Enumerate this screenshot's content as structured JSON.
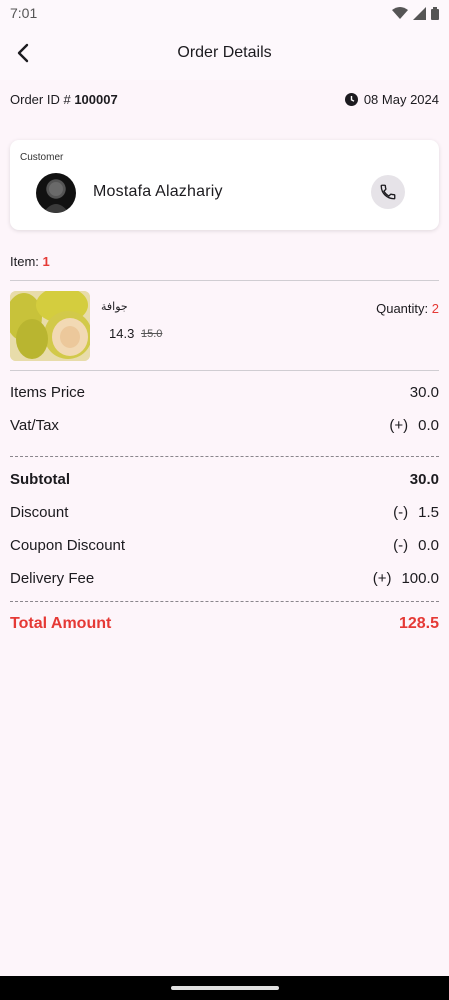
{
  "status_bar": {
    "time": "7:01"
  },
  "app_bar": {
    "title": "Order Details",
    "back_icon": "back-arrow-icon"
  },
  "order": {
    "id_label": "Order ID #",
    "id_value": "100007",
    "date": "08 May 2024",
    "clock_icon": "clock-icon"
  },
  "customer": {
    "label": "Customer",
    "name": "Mostafa Alazhariy",
    "call_icon": "phone-icon"
  },
  "items": {
    "label": "Item:",
    "count": "1",
    "list": [
      {
        "name": "جوافة",
        "price": "14.3",
        "old_price": "15.0",
        "quantity_label": "Quantity:",
        "quantity": "2"
      }
    ]
  },
  "summary": {
    "items_price": {
      "label": "Items Price",
      "value": "30.0"
    },
    "vat": {
      "label": "Vat/Tax",
      "sign": "(+)",
      "value": "0.0"
    },
    "subtotal": {
      "label": "Subtotal",
      "value": "30.0"
    },
    "discount": {
      "label": "Discount",
      "sign": "(-)",
      "value": "1.5"
    },
    "coupon": {
      "label": "Coupon Discount",
      "sign": "(-)",
      "value": "0.0"
    },
    "delivery": {
      "label": "Delivery Fee",
      "sign": "(+)",
      "value": "100.0"
    },
    "total": {
      "label": "Total Amount",
      "value": "128.5"
    }
  },
  "colors": {
    "accent_red": "#e53935",
    "background": "#fdf5fa"
  }
}
